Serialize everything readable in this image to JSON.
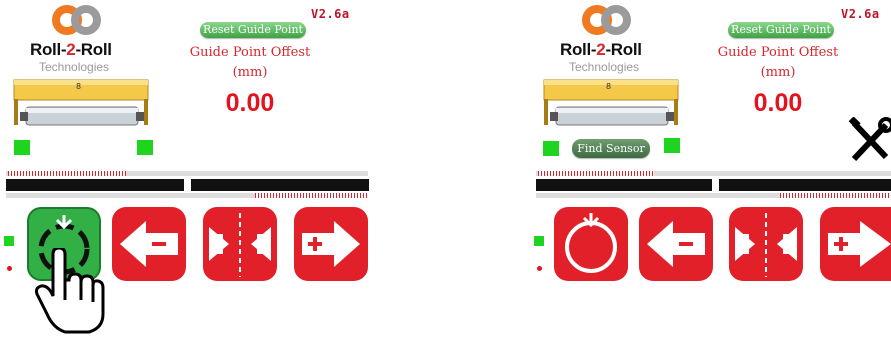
{
  "version": "V2.6a",
  "brand": {
    "part1": "Roll-",
    "part2": "2",
    "part3": "-Roll",
    "subtitle": "Technologies"
  },
  "reset_button_label": "Reset Guide Point",
  "offset_label_line1": "Guide Point Offest",
  "offset_label_line2": "(mm)",
  "offset_value": "0.00",
  "find_sensor_label": "Find Sensor",
  "roller_label": "8",
  "colors": {
    "accent_red": "#e22029",
    "green": "#33b045",
    "indicator_green": "#1fd41f"
  },
  "icons": {
    "auto_mode": "auto-mode-icon",
    "move_left": "move-left-minus-icon",
    "center": "center-icon",
    "move_right": "move-right-plus-icon",
    "hand": "hand-pointer-icon",
    "tools": "tools-icon"
  }
}
